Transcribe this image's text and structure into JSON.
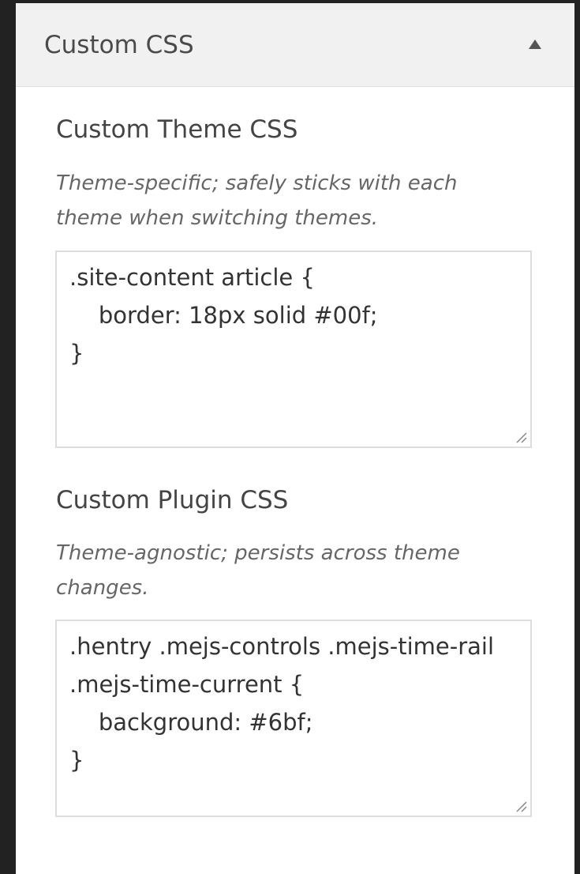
{
  "panel": {
    "title": "Custom CSS",
    "toggle_icon": "triangle-up-icon"
  },
  "theme_css": {
    "title": "Custom Theme CSS",
    "description": "Theme-specific; safely sticks with each theme when switching themes.",
    "value": ".site-content article {\n\tborder: 18px solid #00f;\n}"
  },
  "plugin_css": {
    "title": "Custom Plugin CSS",
    "description": "Theme-agnostic; persists across theme changes.",
    "value": ".hentry .mejs-controls .mejs-time-rail .mejs-time-current {\n\tbackground: #6bf;\n}"
  },
  "colors": {
    "background": "#222222",
    "panel": "#ffffff",
    "header": "#f1f1f1",
    "spellcheck": "#e02020"
  }
}
